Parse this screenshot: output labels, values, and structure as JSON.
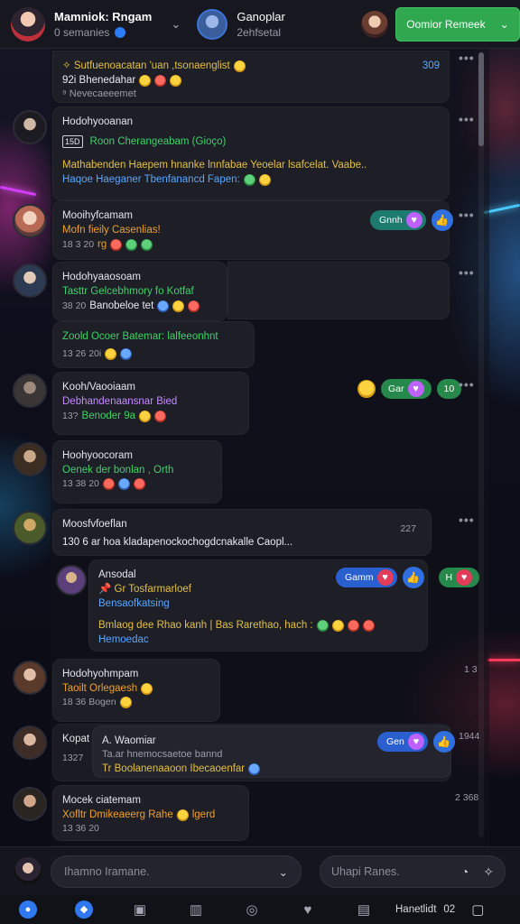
{
  "header": {
    "user_title": "Mamniok: Rngam",
    "user_sub": "0 semanies",
    "channel_title": "Ganoplar",
    "channel_sub": "2ehfsetal",
    "cta_label": "Oomior Remeek"
  },
  "messages": [
    {
      "line1": "✧ Sutfuenoacatan 'uan ,tsonaenglist",
      "line1_time": "309",
      "line2": "92i  Bhenedahar",
      "line3": "⁹  Nevecaeeemet"
    },
    {
      "name": "Hodohyooanan",
      "tag": "15D",
      "line1": "Roon Cherangeabam (Gioço)",
      "line2": "Mathabenden Haepem hnanke lnnfabae Yeoelar lsafcelat. Vaabe..",
      "line3": "Haqoe Haeganer Tbenfanancd Fapen:"
    },
    {
      "name": "Mooihyfcamam",
      "line1": "Mofn  fieily Casenlias!",
      "time": "18 3 20",
      "line2_time": "rg"
    },
    {
      "name": "Hodohyaaosoam",
      "line1": "Tasttr  Gelcebhmory fo Kotfaf",
      "time": "38 20",
      "line2": "Banobeloe tet"
    },
    {
      "line1": "Zoold Ocoer Batemar: lalfeeonhnt",
      "time": "13 26  20i"
    },
    {
      "name": "Kooh/Vaooiaam",
      "line1": "Debhandenaansnar Bied",
      "time": "13?",
      "line2": "Benoder 9a"
    },
    {
      "name": "Hoohyoocoram",
      "line1": "Oenek der bonlan , Orth",
      "time": "13 38  20"
    },
    {
      "name": "Moosfvfoeflan",
      "line1": "130  6 ar hoa kladapenockochogdcnakalle Caopl...",
      "time": "227"
    },
    {
      "name": "Ansodal",
      "line1": "📌 Gr Tosfarmarloef",
      "line2": "Bensaofkatsing",
      "line3": "Bmlaog dee Rhao kanh | Bas Rarethao, hach :",
      "line4": "Hemoedac"
    },
    {
      "name": "Hodohyohmpam",
      "line1": "Taoilt  Orlegaesh",
      "time": "18 36  Bogen",
      "side": "1 3"
    },
    {
      "name": "Kopat",
      "quote_name": "A. Waomiar",
      "line1": "Ta.ar  hnemocsaetoe bannd",
      "time": "1327",
      "line2": "Tr  Boolanenaaoon Ibecaoenfar",
      "side": "1944"
    },
    {
      "name": "Mocek ciatemam",
      "line1": "Xofltr  Dmikeaeerg Rahe",
      "line1b": "lgerd",
      "time": "13 36  20",
      "side": "2 368"
    }
  ],
  "reactions": {
    "r1": "Gnnh",
    "r2": "Gar",
    "r2b": "10",
    "r3": "Gamm",
    "r3b": "H",
    "r4": "Gen"
  },
  "composer": {
    "placeholder1": "Ihamno Iramane.",
    "placeholder2": "Uhapi Ranes."
  },
  "nav": {
    "text": "Hanetlidt",
    "num": "02"
  },
  "colors": {
    "accent_green": "#2fa84f",
    "accent_blue": "#2f78f0",
    "reaction_purple": "#bd62ff"
  }
}
